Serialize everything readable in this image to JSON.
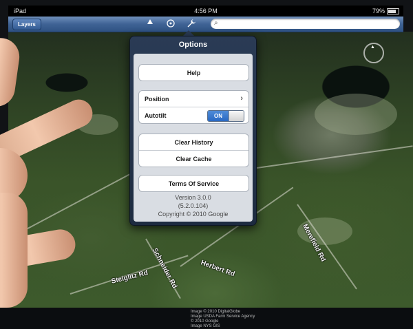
{
  "status_bar": {
    "device": "iPad",
    "time": "4:56 PM",
    "battery": "79%"
  },
  "toolbar": {
    "layers_label": "Layers",
    "north_icon": "north-arrow-icon",
    "north_letter": "N",
    "location_icon": "my-location-icon",
    "options_icon": "wrench-icon",
    "search_placeholder": ""
  },
  "options_popover": {
    "title": "Options",
    "help_label": "Help",
    "position_label": "Position",
    "autotilt_label": "Autotilt",
    "autotilt_state": "ON",
    "clear_history_label": "Clear History",
    "clear_cache_label": "Clear Cache",
    "terms_label": "Terms Of Service",
    "version": "Version 3.0.0",
    "build": "(5.2.0.104)",
    "copyright": "Copyright © 2010 Google"
  },
  "map": {
    "roads": [
      {
        "name": "Steiglitz Rd"
      },
      {
        "name": "Schneider Rd"
      },
      {
        "name": "Herbert Rd"
      },
      {
        "name": "Merefield Rd"
      }
    ],
    "attribution": [
      "Image © 2010 DigitalGlobe",
      "Image USDA Farm Service Agency",
      "© 2010 Google",
      "Image NYS GIS"
    ]
  },
  "colors": {
    "toolbar": "#3f6395",
    "popover": "#2a3b55",
    "toggle_on": "#2868c3"
  }
}
